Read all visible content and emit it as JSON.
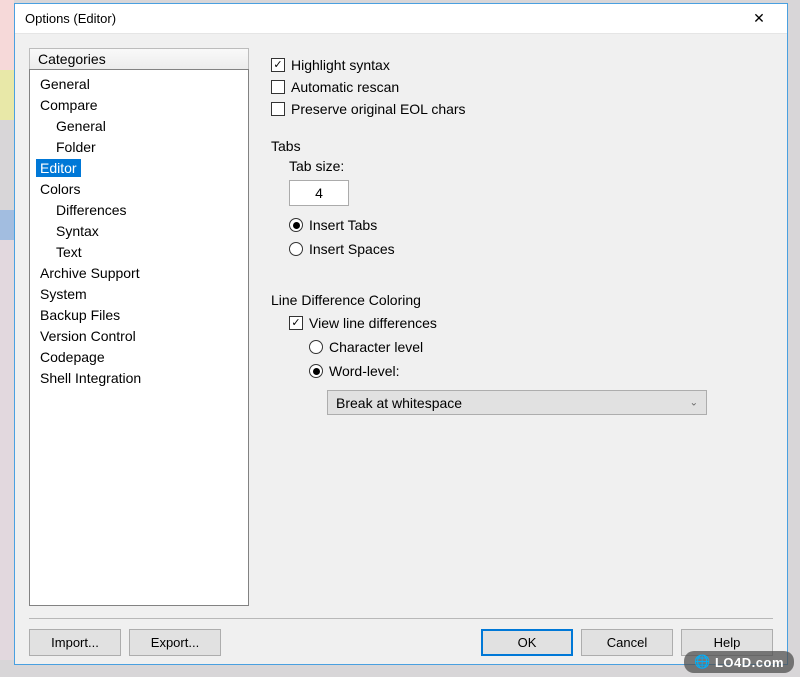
{
  "window": {
    "title": "Options (Editor)"
  },
  "sidebar": {
    "header": "Categories",
    "items": [
      {
        "label": "General",
        "level": 0
      },
      {
        "label": "Compare",
        "level": 0
      },
      {
        "label": "General",
        "level": 1
      },
      {
        "label": "Folder",
        "level": 1
      },
      {
        "label": "Editor",
        "level": 0,
        "selected": true
      },
      {
        "label": "Colors",
        "level": 0
      },
      {
        "label": "Differences",
        "level": 1
      },
      {
        "label": "Syntax",
        "level": 1
      },
      {
        "label": "Text",
        "level": 1
      },
      {
        "label": "Archive Support",
        "level": 0
      },
      {
        "label": "System",
        "level": 0
      },
      {
        "label": "Backup Files",
        "level": 0
      },
      {
        "label": "Version Control",
        "level": 0
      },
      {
        "label": "Codepage",
        "level": 0
      },
      {
        "label": "Shell Integration",
        "level": 0
      }
    ]
  },
  "editor": {
    "highlight_syntax": {
      "label": "Highlight syntax",
      "checked": true
    },
    "automatic_rescan": {
      "label": "Automatic rescan",
      "checked": false
    },
    "preserve_eol": {
      "label": "Preserve original EOL chars",
      "checked": false
    },
    "tabs": {
      "title": "Tabs",
      "tab_size_label": "Tab size:",
      "tab_size_value": "4",
      "insert_tabs": {
        "label": "Insert Tabs",
        "selected": true
      },
      "insert_spaces": {
        "label": "Insert Spaces",
        "selected": false
      }
    },
    "line_diff": {
      "title": "Line Difference Coloring",
      "view_line_diff": {
        "label": "View line differences",
        "checked": true
      },
      "char_level": {
        "label": "Character level",
        "selected": false
      },
      "word_level": {
        "label": "Word-level:",
        "selected": true
      },
      "break_mode": "Break at whitespace"
    }
  },
  "buttons": {
    "import": "Import...",
    "export": "Export...",
    "ok": "OK",
    "cancel": "Cancel",
    "help": "Help"
  },
  "watermark": "LO4D.com"
}
